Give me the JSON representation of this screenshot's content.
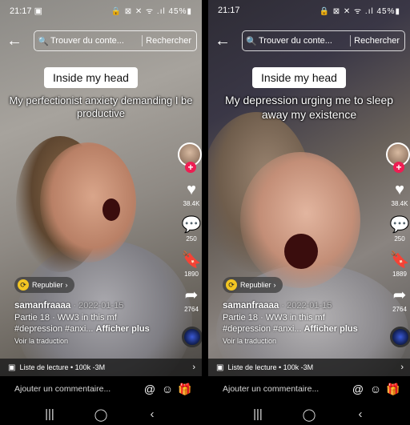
{
  "screens": [
    {
      "status": {
        "time": "21:17",
        "left_icon": "▣",
        "right_icons": "🔒 ⊠ ✕ ᯤ .ıl 45%▮"
      },
      "search": {
        "back_icon": "←",
        "icon": "🔍",
        "placeholder": "Trouver du conte...",
        "button": "Rechercher"
      },
      "caption_box": "Inside my head",
      "overlay_text": "My perfectionist anxiety demanding I be productive",
      "likes": "38.4K",
      "comments": "250",
      "saves": "1890",
      "shares": "2764",
      "republish": "Republier",
      "username": "samanfraaaa",
      "date": "· 2022-01-15",
      "part": "Partie 18 · WW3 in this mf",
      "tags": "#depression #anxi...",
      "more": "Afficher plus",
      "translation": "Voir la traduction",
      "playlist": "Liste de lecture • 100k -3M",
      "comment_placeholder": "Ajouter un commentaire...",
      "save_color": "#f3c623"
    },
    {
      "status": {
        "time": "21:17",
        "left_icon": "",
        "right_icons": "🔒 ⊠ ✕ ᯤ .ıl 45%▮"
      },
      "search": {
        "back_icon": "←",
        "icon": "🔍",
        "placeholder": "Trouver du conte...",
        "button": "Rechercher"
      },
      "caption_box": "Inside my head",
      "overlay_text": "My depression urging me to sleep away my existence",
      "likes": "38.4K",
      "comments": "250",
      "saves": "1889",
      "shares": "2764",
      "republish": "Republier",
      "username": "samanfraaaa",
      "date": "· 2022-01-15",
      "part": "Partie 18 · WW3 in this mf",
      "tags": "#depression #anxi...",
      "more": "Afficher plus",
      "translation": "Voir la traduction",
      "playlist": "Liste de lecture • 100k -3M",
      "comment_placeholder": "Ajouter un commentaire...",
      "save_color": "#ffffff"
    }
  ],
  "icons": {
    "mention": "@",
    "emoji": "☺",
    "gift": "🎁",
    "heart": "♥",
    "comment": "💬",
    "bookmark": "🔖",
    "share": "➦",
    "plus": "+",
    "playlist": "▣",
    "chevron": "›",
    "republish": "⟳"
  },
  "nav": {
    "recent": "|||",
    "home": "◯",
    "back": "‹"
  }
}
